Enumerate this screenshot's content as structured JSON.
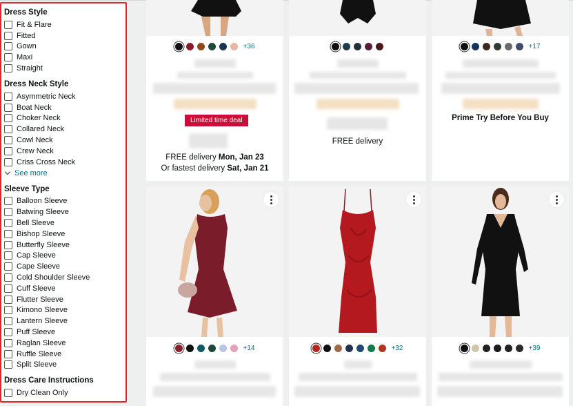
{
  "sidebar": {
    "dress_style": {
      "title": "Dress Style",
      "options": [
        "Fit & Flare",
        "Fitted",
        "Gown",
        "Maxi",
        "Straight"
      ]
    },
    "neck_style": {
      "title": "Dress Neck Style",
      "options": [
        "Asymmetric Neck",
        "Boat Neck",
        "Choker Neck",
        "Collared Neck",
        "Cowl Neck",
        "Crew Neck",
        "Criss Cross Neck"
      ],
      "see_more": "See more"
    },
    "sleeve_type": {
      "title": "Sleeve Type",
      "options": [
        "Balloon Sleeve",
        "Batwing Sleeve",
        "Bell Sleeve",
        "Bishop Sleeve",
        "Butterfly Sleeve",
        "Cap Sleeve",
        "Cape Sleeve",
        "Cold Shoulder Sleeve",
        "Cuff Sleeve",
        "Flutter Sleeve",
        "Kimono Sleeve",
        "Lantern Sleeve",
        "Puff Sleeve",
        "Raglan Sleeve",
        "Ruffle Sleeve",
        "Split Sleeve"
      ]
    },
    "care": {
      "title": "Dress Care Instructions",
      "options": [
        "Dry Clean Only"
      ]
    }
  },
  "products_top": [
    {
      "swatches": [
        "#111111",
        "#8b1a2b",
        "#8a4a1c",
        "#1d4a3a",
        "#1a3552",
        "#e8b5a6"
      ],
      "more": "+36",
      "deal": "Limited time deal",
      "delivery_line1_prefix": "FREE delivery ",
      "delivery_line1_date": "Mon, Jan 23",
      "delivery_line2_prefix": "Or fastest delivery ",
      "delivery_line2_date": "Sat, Jan 21"
    },
    {
      "swatches": [
        "#111111",
        "#1f3d4d",
        "#23313a",
        "#5a1d3a",
        "#4a1a1a"
      ],
      "delivery": "FREE delivery"
    },
    {
      "swatches": [
        "#111111",
        "#16355a",
        "#3a2a22",
        "#2f3b33",
        "#6b6b6b",
        "#404a6a"
      ],
      "more": "+17",
      "prime": "Prime Try Before You Buy"
    }
  ],
  "products_bottom": [
    {
      "swatches": [
        "#8b1f2a",
        "#111111",
        "#0e5a63",
        "#1d4a3a",
        "#b9c4e6",
        "#e6a0b8"
      ],
      "more": "+14"
    },
    {
      "swatches": [
        "#b3261e",
        "#111111",
        "#a06a4a",
        "#23304f",
        "#1d4a73",
        "#0f7a4a",
        "#b3351e"
      ],
      "more": "+32"
    },
    {
      "swatches": [
        "#111111",
        "#cfc5a8",
        "#222222",
        "#1a1a1a",
        "#222222",
        "#2a2a2a"
      ],
      "more": "+39"
    }
  ],
  "colors": {
    "accent_link": "#007185",
    "deal_red": "#cc0c39",
    "filter_outline": "#e3242b"
  }
}
